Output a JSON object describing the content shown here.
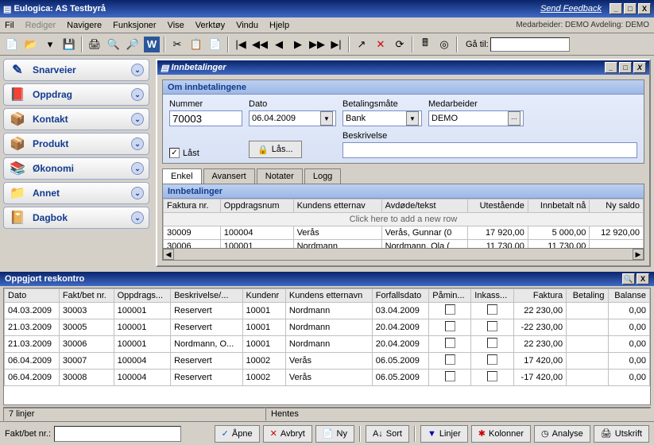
{
  "window": {
    "title": "Eulogica: AS Testbyrå",
    "feedback": "Send Feedback"
  },
  "menu": {
    "items": [
      "Fil",
      "Rediger",
      "Navigere",
      "Funksjoner",
      "Vise",
      "Verktøy",
      "Vindu",
      "Hjelp"
    ],
    "disabled_index": 1,
    "right": "Medarbeider: DEMO  Avdeling: DEMO",
    "goto_label": "Gå til:",
    "goto_value": ""
  },
  "sidebar": {
    "items": [
      {
        "label": "Snarveier",
        "icon": "✎"
      },
      {
        "label": "Oppdrag",
        "icon": "📕"
      },
      {
        "label": "Kontakt",
        "icon": "📦"
      },
      {
        "label": "Produkt",
        "icon": "📦"
      },
      {
        "label": "Økonomi",
        "icon": "📚"
      },
      {
        "label": "Annet",
        "icon": "📁"
      },
      {
        "label": "Dagbok",
        "icon": "📔"
      }
    ]
  },
  "panel": {
    "title": "Innbetalinger",
    "group_title": "Om innbetalingene",
    "fields": {
      "nummer_label": "Nummer",
      "nummer": "70003",
      "dato_label": "Dato",
      "dato": "06.04.2009",
      "betal_label": "Betalingsmåte",
      "betal": "Bank",
      "medarb_label": "Medarbeider",
      "medarb": "DEMO",
      "beskriv_label": "Beskrivelse",
      "beskriv": "",
      "last_label": "Låst",
      "last_checked": "✓",
      "las_btn": "Lås..."
    },
    "tabs": [
      "Enkel",
      "Avansert",
      "Notater",
      "Logg"
    ],
    "active_tab": 0,
    "inner_title": "Innbetalinger",
    "cols": [
      "Faktura nr.",
      "Oppdragsnum",
      "Kundens etternav",
      "Avdøde/tekst",
      "Utestående",
      "Innbetalt nå",
      "Ny saldo"
    ],
    "newrow": "Click here to add a new row",
    "rows": [
      {
        "c": [
          "30009",
          "100004",
          "Verås",
          "Verås, Gunnar (0",
          "17 920,00",
          "5 000,00",
          "12 920,00"
        ]
      },
      {
        "c": [
          "30006",
          "100001",
          "Nordmann",
          "Nordmann, Ola (",
          "11 730,00",
          "11 730,00",
          ""
        ]
      }
    ]
  },
  "lower": {
    "title": "Oppgjort reskontro",
    "cols": [
      "Dato",
      "Fakt/bet nr.",
      "Oppdrags...",
      "Beskrivelse/...",
      "Kundenr",
      "Kundens etternavn",
      "Forfallsdato",
      "Påmin...",
      "Inkass...",
      "Faktura",
      "Betaling",
      "Balanse"
    ],
    "rows": [
      {
        "c": [
          "04.03.2009",
          "30003",
          "100001",
          "Reservert",
          "10001",
          "Nordmann",
          "03.04.2009",
          "",
          "",
          "22 230,00",
          "",
          "0,00"
        ]
      },
      {
        "c": [
          "21.03.2009",
          "30005",
          "100001",
          "Reservert",
          "10001",
          "Nordmann",
          "20.04.2009",
          "",
          "",
          "-22 230,00",
          "",
          "0,00"
        ]
      },
      {
        "c": [
          "21.03.2009",
          "30006",
          "100001",
          "Nordmann, O...",
          "10001",
          "Nordmann",
          "20.04.2009",
          "",
          "",
          "22 230,00",
          "",
          "0,00"
        ]
      },
      {
        "c": [
          "06.04.2009",
          "30007",
          "100004",
          "Reservert",
          "10002",
          "Verås",
          "06.05.2009",
          "",
          "",
          "17 420,00",
          "",
          "0,00"
        ]
      },
      {
        "c": [
          "06.04.2009",
          "30008",
          "100004",
          "Reservert",
          "10002",
          "Verås",
          "06.05.2009",
          "",
          "",
          "-17 420,00",
          "",
          "0,00"
        ]
      }
    ]
  },
  "status": {
    "left": "7 linjer",
    "right": "Hentes"
  },
  "bottom": {
    "label": "Fakt/bet nr.:",
    "value": "",
    "apne": "Åpne",
    "avbryt": "Avbryt",
    "ny": "Ny",
    "sort": "Sort",
    "linjer": "Linjer",
    "kolonner": "Kolonner",
    "analyse": "Analyse",
    "utskrift": "Utskrift"
  }
}
